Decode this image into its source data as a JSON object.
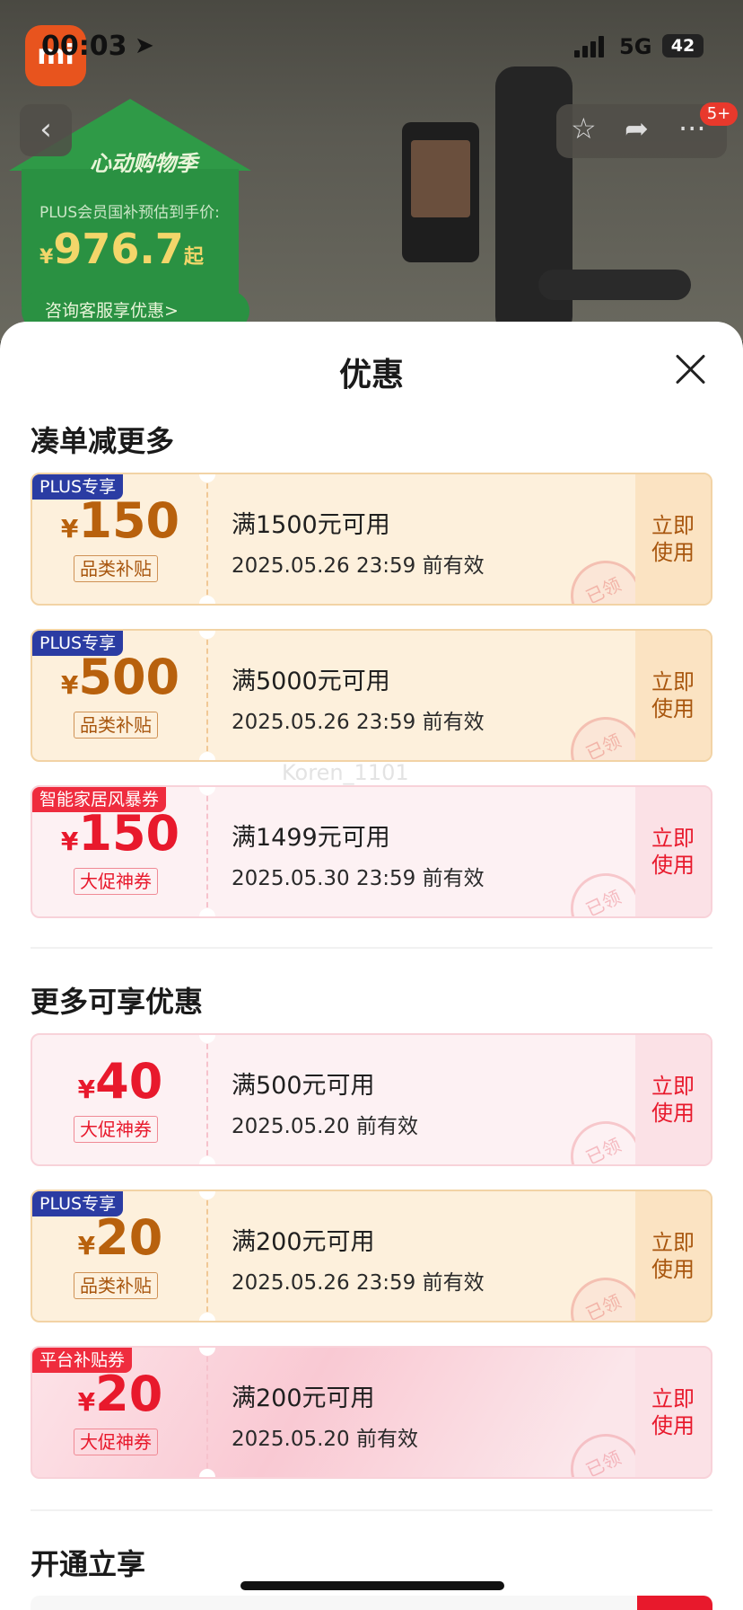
{
  "status_bar": {
    "time": "00:03",
    "network": "5G",
    "battery": "42"
  },
  "background": {
    "app_logo": "mi",
    "promo": {
      "brand": "心动购物季",
      "subtitle": "PLUS会员国补预估到手价:",
      "currency": "¥",
      "price": "976.7",
      "suffix": "起",
      "consult": "咨询客服享优惠>"
    },
    "badge": "5+"
  },
  "sheet": {
    "title": "优惠",
    "watermark": "Koren_1101",
    "sections": [
      {
        "title": "凑单减更多",
        "coupons": [
          {
            "style": "gold",
            "tag": "PLUS专享",
            "currency": "¥",
            "amount": "150",
            "kind": "品类补贴",
            "condition": "满1500元可用",
            "date": "2025.05.26 23:59 前有效",
            "action": "立即使用",
            "stamp": "已领"
          },
          {
            "style": "gold",
            "tag": "PLUS专享",
            "currency": "¥",
            "amount": "500",
            "kind": "品类补贴",
            "condition": "满5000元可用",
            "date": "2025.05.26 23:59 前有效",
            "action": "立即使用",
            "stamp": "已领"
          },
          {
            "style": "red",
            "tag": "智能家居风暴券",
            "currency": "¥",
            "amount": "150",
            "kind": "大促神券",
            "condition": "满1499元可用",
            "date": "2025.05.30 23:59 前有效",
            "action": "立即使用",
            "stamp": "已领"
          }
        ]
      },
      {
        "title": "更多可享优惠",
        "coupons": [
          {
            "style": "red",
            "tag": "",
            "currency": "¥",
            "amount": "40",
            "kind": "大促神券",
            "condition": "满500元可用",
            "date": "2025.05.20 前有效",
            "action": "立即使用",
            "stamp": "已领"
          },
          {
            "style": "gold",
            "tag": "PLUS专享",
            "currency": "¥",
            "amount": "20",
            "kind": "品类补贴",
            "condition": "满200元可用",
            "date": "2025.05.26 23:59 前有效",
            "action": "立即使用",
            "stamp": "已领"
          },
          {
            "style": "pinkbg",
            "tag": "平台补贴券",
            "currency": "¥",
            "amount": "20",
            "kind": "大促神券",
            "condition": "满200元可用",
            "date": "2025.05.20 前有效",
            "action": "立即使用",
            "stamp": "已领"
          }
        ]
      },
      {
        "title": "开通立享",
        "coupons": []
      }
    ]
  }
}
